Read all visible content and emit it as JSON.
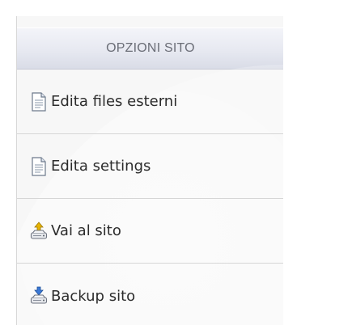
{
  "panel": {
    "title": "OPZIONI SITO",
    "items": [
      {
        "label": "Edita files esterni",
        "icon": "document-icon"
      },
      {
        "label": "Edita settings",
        "icon": "document-icon"
      },
      {
        "label": "Vai al sito",
        "icon": "upload-drive-icon"
      },
      {
        "label": "Backup sito",
        "icon": "download-drive-icon"
      }
    ]
  },
  "colors": {
    "header_bg": "#e4e6ef",
    "header_text": "#6b6e77",
    "panel_bg": "#f7f7f7",
    "divider": "#d6d6d6",
    "text": "#2c2c2c",
    "icon_up_arrow": "#e8b400",
    "icon_down_arrow": "#3a78d6"
  }
}
